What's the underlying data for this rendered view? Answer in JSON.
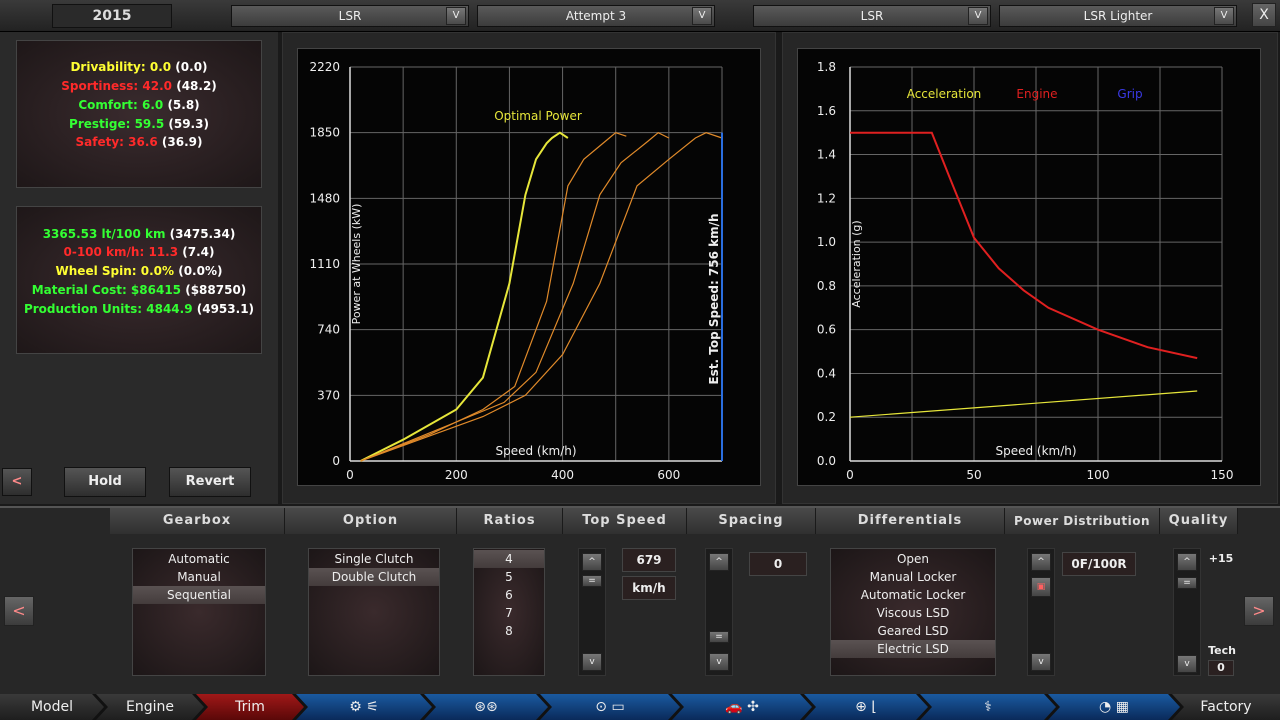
{
  "topbar": {
    "year": "2015",
    "dropdowns": [
      {
        "label": "LSR"
      },
      {
        "label": "Attempt 3"
      },
      {
        "label": "LSR"
      },
      {
        "label": "LSR Lighter"
      }
    ],
    "dropdown_arrow": "V",
    "close": "X"
  },
  "stats1": [
    {
      "label": "Drivability: 0.0",
      "paren": "(0.0)",
      "color": "#ffff33"
    },
    {
      "label": "Sportiness: 42.0",
      "paren": "(48.2)",
      "color": "#ff2a2a"
    },
    {
      "label": "Comfort: 6.0",
      "paren": "(5.8)",
      "color": "#33ff33"
    },
    {
      "label": "Prestige: 59.5",
      "paren": "(59.3)",
      "color": "#33ff33"
    },
    {
      "label": "Safety: 36.6",
      "paren": "(36.9)",
      "color": "#ff2a2a"
    }
  ],
  "stats2": [
    {
      "label": "3365.53 lt/100 km",
      "paren": "(3475.34)",
      "color": "#33ff33"
    },
    {
      "label": "0-100 km/h: 11.3",
      "paren": "(7.4)",
      "color": "#ff2a2a"
    },
    {
      "label": "Wheel Spin: 0.0%",
      "paren": "(0.0%)",
      "color": "#ffff33"
    },
    {
      "label": "Material Cost: $86415",
      "paren": "($88750)",
      "color": "#33ff33"
    },
    {
      "label": "Production Units: 4844.9",
      "paren": "(4953.1)",
      "color": "#33ff33"
    }
  ],
  "left_buttons": {
    "back": "<",
    "hold": "Hold",
    "revert": "Revert"
  },
  "power_chart": {
    "y_ticks": [
      "2220",
      "1850",
      "1480",
      "1110",
      "740",
      "370",
      "0"
    ],
    "x_ticks": [
      "0",
      "200",
      "400",
      "600"
    ],
    "ylabel": "Power at Wheels (kW)",
    "xlabel": "Speed (km/h)",
    "optimal_label": "Optimal Power",
    "top_speed_label": "Est. Top Speed: 756 km/h",
    "colors": {
      "optimal": "#e6e63a",
      "gear": "#e08a2a",
      "top_speed": "#2a6ee0"
    }
  },
  "accel_chart": {
    "y_ticks": [
      "1.8",
      "1.6",
      "1.4",
      "1.2",
      "1.0",
      "0.8",
      "0.6",
      "0.4",
      "0.2",
      "0.0"
    ],
    "x_ticks": [
      "0",
      "50",
      "100",
      "150"
    ],
    "ylabel": "Acceleration (g)",
    "xlabel": "Speed (km/h)",
    "legend": [
      {
        "label": "Acceleration",
        "color": "#e6e63a"
      },
      {
        "label": "Engine",
        "color": "#e02020"
      },
      {
        "label": "Grip",
        "color": "#3a3ae6"
      }
    ]
  },
  "chart_data": [
    {
      "type": "line",
      "xlabel": "Speed (km/h)",
      "ylabel": "Power at Wheels (kW)",
      "xlim": [
        0,
        700
      ],
      "ylim": [
        0,
        2220
      ],
      "series": [
        {
          "name": "Optimal Power",
          "x": [
            20,
            100,
            200,
            250,
            300,
            330,
            350,
            370,
            380,
            395,
            410
          ],
          "y": [
            0,
            120,
            290,
            470,
            1000,
            1500,
            1700,
            1790,
            1820,
            1850,
            1820
          ]
        },
        {
          "x": [
            20,
            150,
            250,
            310,
            370,
            410,
            440,
            480,
            500,
            520
          ],
          "y": [
            0,
            150,
            290,
            420,
            900,
            1550,
            1700,
            1800,
            1850,
            1830
          ]
        },
        {
          "x": [
            20,
            200,
            290,
            350,
            420,
            470,
            510,
            560,
            580,
            600
          ],
          "y": [
            0,
            220,
            330,
            500,
            1000,
            1500,
            1680,
            1800,
            1850,
            1820
          ]
        },
        {
          "x": [
            20,
            250,
            330,
            400,
            470,
            540,
            600,
            650,
            670,
            700
          ],
          "y": [
            0,
            250,
            370,
            600,
            1000,
            1550,
            1700,
            1820,
            1850,
            1820
          ]
        }
      ],
      "top_speed_label": "Est. Top Speed: 756 km/h"
    },
    {
      "type": "line",
      "xlabel": "Speed (km/h)",
      "ylabel": "Acceleration (g)",
      "xlim": [
        0,
        150
      ],
      "ylim": [
        0,
        1.8
      ],
      "series": [
        {
          "name": "Engine",
          "x": [
            0,
            33,
            40,
            50,
            60,
            70,
            80,
            100,
            120,
            140
          ],
          "y": [
            1.5,
            1.5,
            1.3,
            1.02,
            0.88,
            0.78,
            0.7,
            0.6,
            0.52,
            0.47
          ]
        },
        {
          "name": "Acceleration",
          "x": [
            0,
            140
          ],
          "y": [
            0.2,
            0.32
          ]
        }
      ]
    }
  ],
  "bottom": {
    "headers": {
      "gearbox": "Gearbox",
      "option": "Option",
      "ratios": "Ratios",
      "top_speed": "Top Speed",
      "spacing": "Spacing",
      "differentials": "Differentials",
      "power_distribution": "Power Distribution",
      "quality": "Quality"
    },
    "gearbox_items": [
      "Automatic",
      "Manual",
      "Sequential"
    ],
    "gearbox_selected": 2,
    "option_items": [
      "Single Clutch",
      "Double Clutch"
    ],
    "option_selected": 1,
    "ratio_items": [
      "4",
      "5",
      "6",
      "7",
      "8"
    ],
    "ratio_selected": 0,
    "top_speed_value": "679",
    "top_speed_unit": "km/h",
    "spacing_value": "0",
    "diff_items": [
      "Open",
      "Manual Locker",
      "Automatic Locker",
      "Viscous LSD",
      "Geared LSD",
      "Electric LSD"
    ],
    "diff_selected": 5,
    "power_dist_value": "0F/100R",
    "quality_value": "+15",
    "tech_label": "Tech",
    "tech_value": "0",
    "left_arrow": "<",
    "right_arrow": ">",
    "up": "^",
    "down": "v",
    "mid": "="
  },
  "nav": {
    "tabs": [
      {
        "label": "Model"
      },
      {
        "label": "Engine"
      },
      {
        "label": "Trim"
      },
      {
        "label": "⚙ ⚟"
      },
      {
        "label": "⊛⊛"
      },
      {
        "label": "⊙ ▭"
      },
      {
        "label": "🚗 ✣"
      },
      {
        "label": "⊕ ⌊"
      },
      {
        "label": "⚕"
      },
      {
        "label": "◔ ▦"
      },
      {
        "label": "Factory"
      }
    ]
  }
}
